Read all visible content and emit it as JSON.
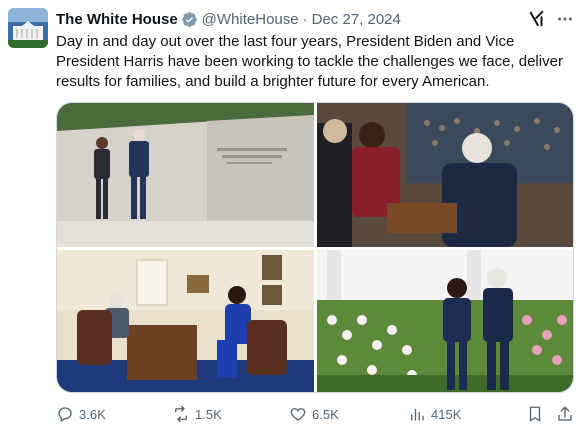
{
  "author": {
    "name": "The White House",
    "handle": "@WhiteHouse",
    "separator": "·",
    "date": "Dec 27, 2024"
  },
  "tweet": {
    "text": "Day in and day out over the last four years, President Biden and Vice President Harris have been working to tackle the challenges we face, deliver results for families, and build a brighter future for every American."
  },
  "media": {
    "photos": [
      {
        "label": "walking-by-memorial-wall"
      },
      {
        "label": "handshake-at-state-of-the-union"
      },
      {
        "label": "meeting-in-oval-office"
      },
      {
        "label": "walking-in-rose-garden"
      }
    ]
  },
  "actions": {
    "replies": "3.6K",
    "reposts": "1.5K",
    "likes": "6.5K",
    "views": "415K"
  },
  "colors": {
    "verified": "#829aab",
    "secondary_text": "#536471",
    "primary_text": "#0f1419"
  },
  "icons": [
    "grok-icon",
    "more-icon",
    "reply-icon",
    "repost-icon",
    "like-icon",
    "views-icon",
    "bookmark-icon",
    "share-icon"
  ]
}
